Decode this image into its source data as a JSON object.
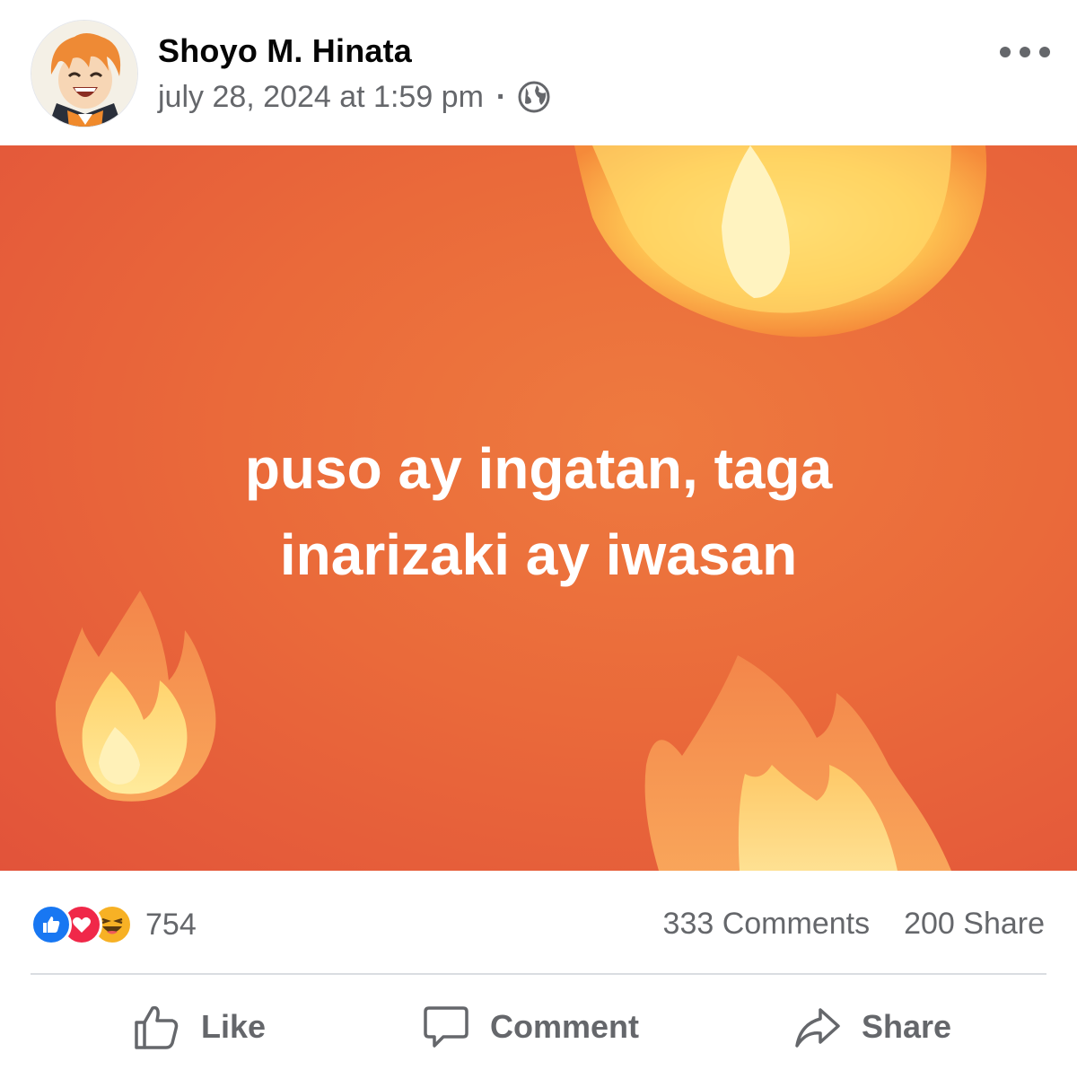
{
  "post": {
    "author": "Shoyo M. Hinata",
    "timestamp": "july 28, 2024 at 1:59 pm",
    "separator": "·",
    "privacy_icon": "globe-icon",
    "more_icon": "more-options-icon",
    "banner": {
      "lines": [
        "puso ay ingatan, taga",
        "inarizaki ay iwasan"
      ],
      "background_color": "#e9633b",
      "decoration_icon": "fire-emoji"
    },
    "reactions": {
      "icons": [
        "like-reaction-icon",
        "love-reaction-icon",
        "haha-reaction-icon"
      ],
      "count": "754"
    },
    "comments_count": "333 Comments",
    "shares_count": "200 Share",
    "actions": {
      "like_label": "Like",
      "comment_label": "Comment",
      "share_label": "Share"
    }
  },
  "colors": {
    "text_primary": "#050505",
    "text_secondary": "#65676b",
    "like_blue": "#1877f2",
    "love_red": "#f02849",
    "haha_yellow": "#f7b125"
  }
}
